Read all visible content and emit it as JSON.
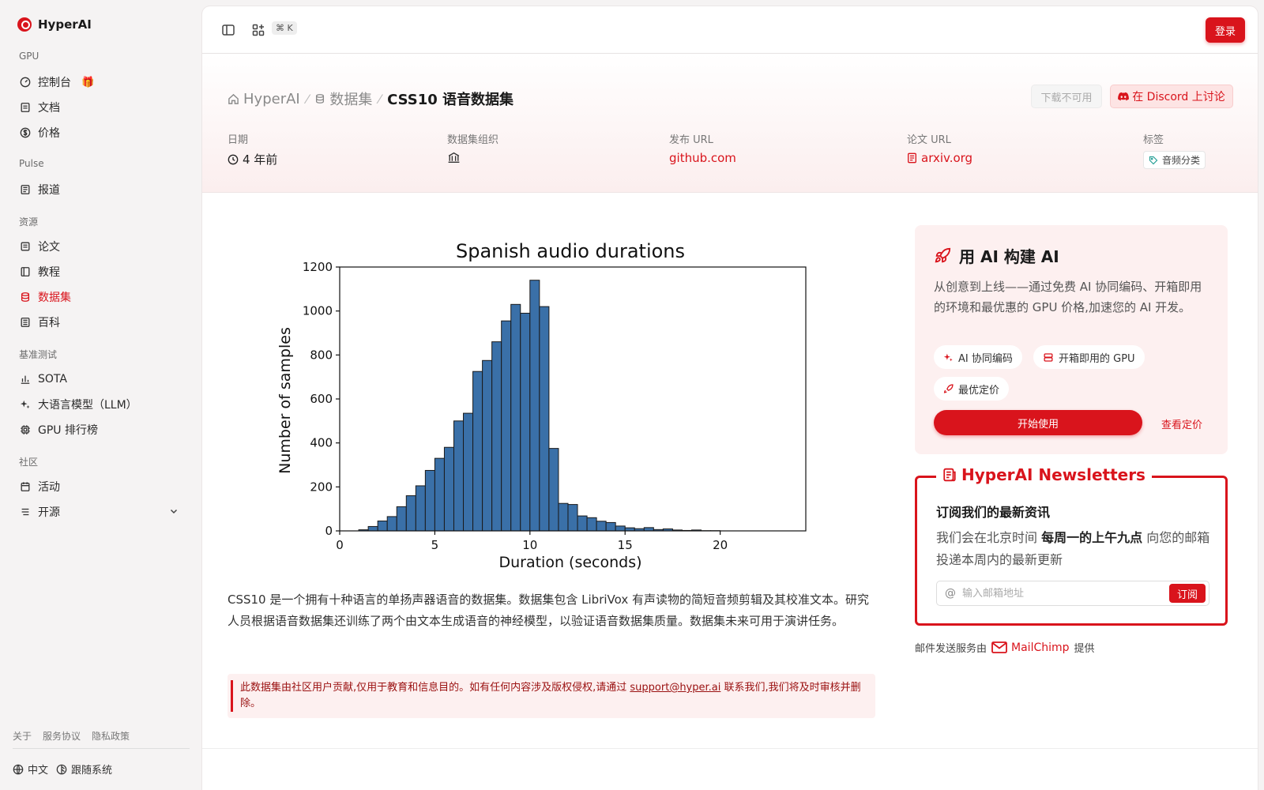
{
  "brand": {
    "name": "HyperAI"
  },
  "sidebar": {
    "sections": [
      {
        "label": "GPU",
        "items": [
          {
            "label": "控制台",
            "icon": "dashboard-icon",
            "badge": "gift-icon"
          },
          {
            "label": "文档",
            "icon": "doc-icon"
          },
          {
            "label": "价格",
            "icon": "dollar-icon"
          }
        ]
      },
      {
        "label": "Pulse",
        "items": [
          {
            "label": "报道",
            "icon": "news-icon"
          }
        ]
      },
      {
        "label": "资源",
        "items": [
          {
            "label": "论文",
            "icon": "paper-icon"
          },
          {
            "label": "教程",
            "icon": "book-icon"
          },
          {
            "label": "数据集",
            "icon": "database-icon",
            "active": true
          },
          {
            "label": "百科",
            "icon": "wiki-icon"
          }
        ]
      },
      {
        "label": "基准测试",
        "items": [
          {
            "label": "SOTA",
            "icon": "chart-icon"
          },
          {
            "label": "大语言模型（LLM）",
            "icon": "sparkle-icon"
          },
          {
            "label": "GPU 排行榜",
            "icon": "cpu-icon"
          }
        ]
      },
      {
        "label": "社区",
        "items": [
          {
            "label": "活动",
            "icon": "calendar-icon"
          },
          {
            "label": "开源",
            "icon": "list-icon"
          }
        ]
      }
    ],
    "footer_links": [
      "关于",
      "服务协议",
      "隐私政策"
    ],
    "language": "中文",
    "theme": "跟随系统"
  },
  "topbar": {
    "shortcut": "⌘ K",
    "login_label": "登录"
  },
  "breadcrumb": {
    "home": "HyperAI",
    "section": "数据集",
    "current": "CSS10 语音数据集"
  },
  "actions": {
    "download": "下载不可用",
    "discord": "在 Discord 上讨论"
  },
  "meta": {
    "date_label": "日期",
    "date_value": "4 年前",
    "org_label": "数据集组织",
    "release_label": "发布 URL",
    "release_value": "github.com",
    "paper_label": "论文 URL",
    "paper_value": "arxiv.org",
    "tags_label": "标签",
    "tag_value": "音频分类"
  },
  "chart_data": {
    "type": "bar",
    "title": "Spanish audio durations",
    "xlabel": "Duration (seconds)",
    "ylabel": "Number of samples",
    "xlim": [
      0,
      24.5
    ],
    "ylim": [
      0,
      1200
    ],
    "xticks": [
      0,
      5,
      10,
      15,
      20
    ],
    "yticks": [
      0,
      200,
      400,
      600,
      800,
      1000,
      1200
    ],
    "bin_width": 0.5,
    "bins_start": [
      1.0,
      1.5,
      2.0,
      2.5,
      3.0,
      3.5,
      4.0,
      4.5,
      5.0,
      5.5,
      6.0,
      6.5,
      7.0,
      7.5,
      8.0,
      8.5,
      9.0,
      9.5,
      10.0,
      10.5,
      11.0,
      11.5,
      12.0,
      12.5,
      13.0,
      13.5,
      14.0,
      14.5,
      15.0,
      15.5,
      16.0,
      16.5,
      17.0,
      17.5,
      18.0,
      18.5,
      19.0,
      19.5
    ],
    "counts": [
      5,
      20,
      45,
      65,
      110,
      160,
      205,
      275,
      330,
      380,
      500,
      535,
      725,
      775,
      860,
      955,
      1030,
      990,
      1140,
      1020,
      375,
      125,
      120,
      68,
      60,
      44,
      38,
      22,
      14,
      10,
      15,
      6,
      9,
      4,
      2,
      4,
      1,
      1
    ],
    "bar_color": "#3a70a8",
    "edge_color": "#1a1a1a"
  },
  "description": "CSS10 是一个拥有十种语言的单扬声器语音的数据集。数据集包含 LibriVox 有声读物的简短音频剪辑及其校准文本。研究人员根据语音数据集还训练了两个由文本生成语音的神经模型，以验证语音数据集质量。数据集未来可用于演讲任务。",
  "notice": {
    "before": "此数据集由社区用户贡献,仅用于教育和信息目的。如有任何内容涉及版权侵权,请通过 ",
    "email": "support@hyper.ai",
    "after": " 联系我们,我们将及时审核并删除。"
  },
  "promo": {
    "title": "用 AI 构建 AI",
    "desc": "从创意到上线——通过免费 AI 协同编码、开箱即用的环境和最优惠的 GPU 价格,加速您的 AI 开发。",
    "chips": [
      "AI 协同编码",
      "开箱即用的 GPU",
      "最优定价"
    ],
    "cta": "开始使用",
    "pricing": "查看定价"
  },
  "newsletter": {
    "legend": "HyperAI Newsletters",
    "title": "订阅我们的最新资讯",
    "desc_before": "我们会在北京时间 ",
    "desc_bold": "每周一的上午九点",
    "desc_after": " 向您的邮箱投递本周内的最新更新",
    "placeholder": "输入邮箱地址",
    "subscribe": "订阅"
  },
  "mail_credit": {
    "before": "邮件发送服务由",
    "brand": "MailChimp",
    "after": "提供"
  },
  "colors": {
    "accent": "#d9141c",
    "promo_bg": "#fdf0f0"
  }
}
